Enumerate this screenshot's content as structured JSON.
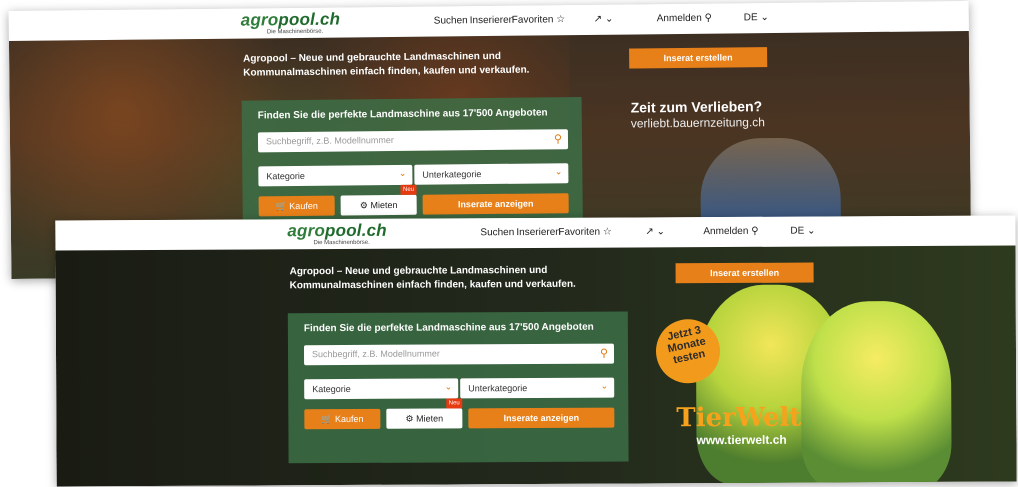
{
  "colors": {
    "accent": "#e8801a",
    "brand": "#2f7d3a",
    "panel": "#3c6e46"
  },
  "header": {
    "logo_part1": "agro",
    "logo_part2": "pool.ch",
    "logo_sub": "Die Maschinenbörse.",
    "nav": {
      "suchen": "Suchen",
      "inserieren": "Inserieren",
      "favoriten": "Favoriten",
      "external": "↗",
      "anmelden": "Anmelden",
      "lang": "DE"
    }
  },
  "hero": {
    "tagline_line1": "Agropool – Neue und gebrauchte Landmaschinen und",
    "tagline_line2": "Kommunalmaschinen einfach finden, kaufen und verkaufen.",
    "cta": "Inserat erstellen"
  },
  "search_panel": {
    "title": "Finden Sie die perfekte Landmaschine aus 17'500 Angeboten",
    "search_placeholder": "Suchbegriff, z.B. Modellnummer",
    "kategorie": "Kategorie",
    "unterkategorie": "Unterkategorie",
    "kaufen": "Kaufen",
    "mieten": "Mieten",
    "neu_badge": "Neu",
    "show": "Inserate anzeigen"
  },
  "ads": {
    "ad1_title": "Zeit zum Verlieben?",
    "ad1_url": "verliebt.bauernzeitung.ch",
    "ad2_badge": "Jetzt 3 Monate testen",
    "ad2_brand": "TierWelt",
    "ad2_url": "www.tierwelt.ch"
  }
}
